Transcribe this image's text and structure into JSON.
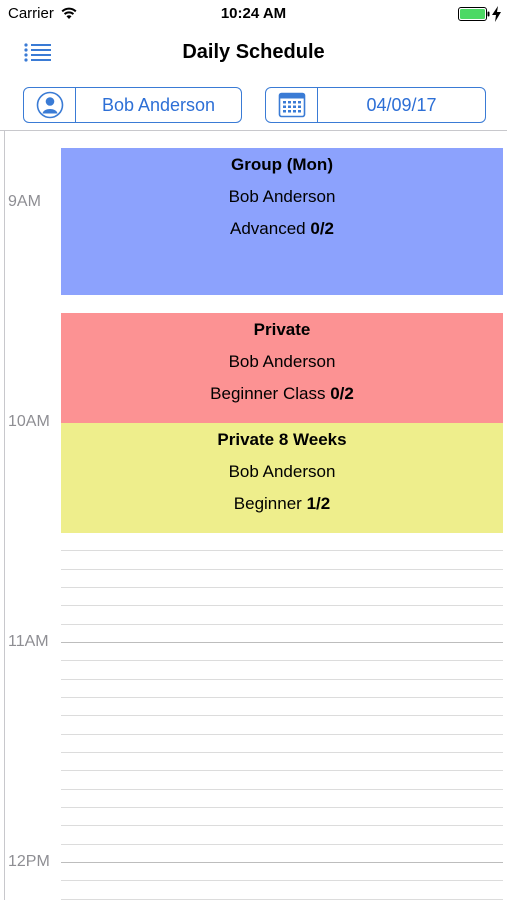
{
  "status_bar": {
    "carrier": "Carrier",
    "time": "10:24 AM",
    "icons": [
      "wifi-icon",
      "battery-icon",
      "charging-bolt-icon"
    ]
  },
  "nav": {
    "title": "Daily Schedule",
    "menu_icon": "list-menu-icon"
  },
  "filters": {
    "user": {
      "label": "Bob Anderson",
      "icon": "person-icon"
    },
    "date": {
      "label": "04/09/17",
      "icon": "calendar-icon"
    }
  },
  "timeline": {
    "hours": [
      "9AM",
      "10AM",
      "11AM",
      "12PM"
    ],
    "events": [
      {
        "title": "Group (Mon)",
        "person": "Bob Anderson",
        "level": "Advanced",
        "count": "0/2",
        "color": "#8ca2fd"
      },
      {
        "title": "Private",
        "person": "Bob Anderson",
        "level": "Beginner Class",
        "count": "0/2",
        "color": "#fc9293"
      },
      {
        "title": "Private 8 Weeks",
        "person": "Bob Anderson",
        "level": "Beginner",
        "count": "1/2",
        "color": "#eeee8c"
      }
    ]
  },
  "colors": {
    "accent": "#2d6fd6",
    "battery": "#4cd964"
  }
}
